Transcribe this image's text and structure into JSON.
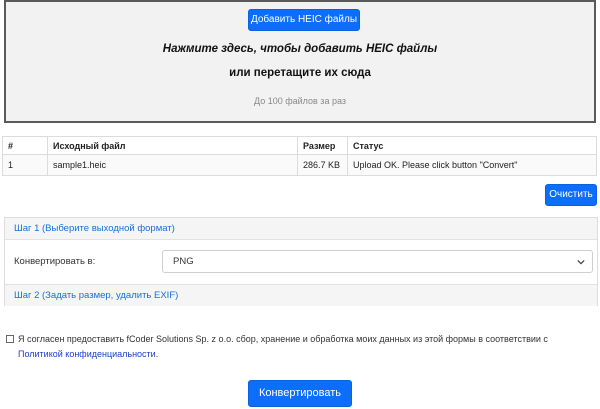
{
  "dropzone": {
    "add_button": "Добавить HEIC файлы",
    "line1": "Нажмите здесь, чтобы добавить HEIC файлы",
    "line2": "или перетащите их сюда",
    "limit": "До 100 файлов за раз"
  },
  "table": {
    "headers": [
      "#",
      "Исходный файл",
      "Размер",
      "Статус"
    ],
    "rows": [
      [
        "1",
        "sample1.heic",
        "286.7 KB",
        "Upload OK. Please click button \"Convert\""
      ]
    ]
  },
  "clear_button": "Очистить",
  "step1": {
    "header": "Шаг 1 (Выберите выходной формат)",
    "label": "Конвертировать в:",
    "selected_format": "PNG"
  },
  "step2": {
    "header": "Шаг 2 (Задать размер, удалить EXIF)"
  },
  "consent": {
    "text": "Я согласен предоставить fCoder Solutions Sp. z o.o. сбор, хранение и обработка моих данных из этой формы в соответствии с",
    "link": "Политикой конфиденциальности",
    "suffix": "."
  },
  "convert_button": "Конвертировать",
  "colors": {
    "accent": "#0d6efd",
    "link": "#1a6fd6"
  }
}
